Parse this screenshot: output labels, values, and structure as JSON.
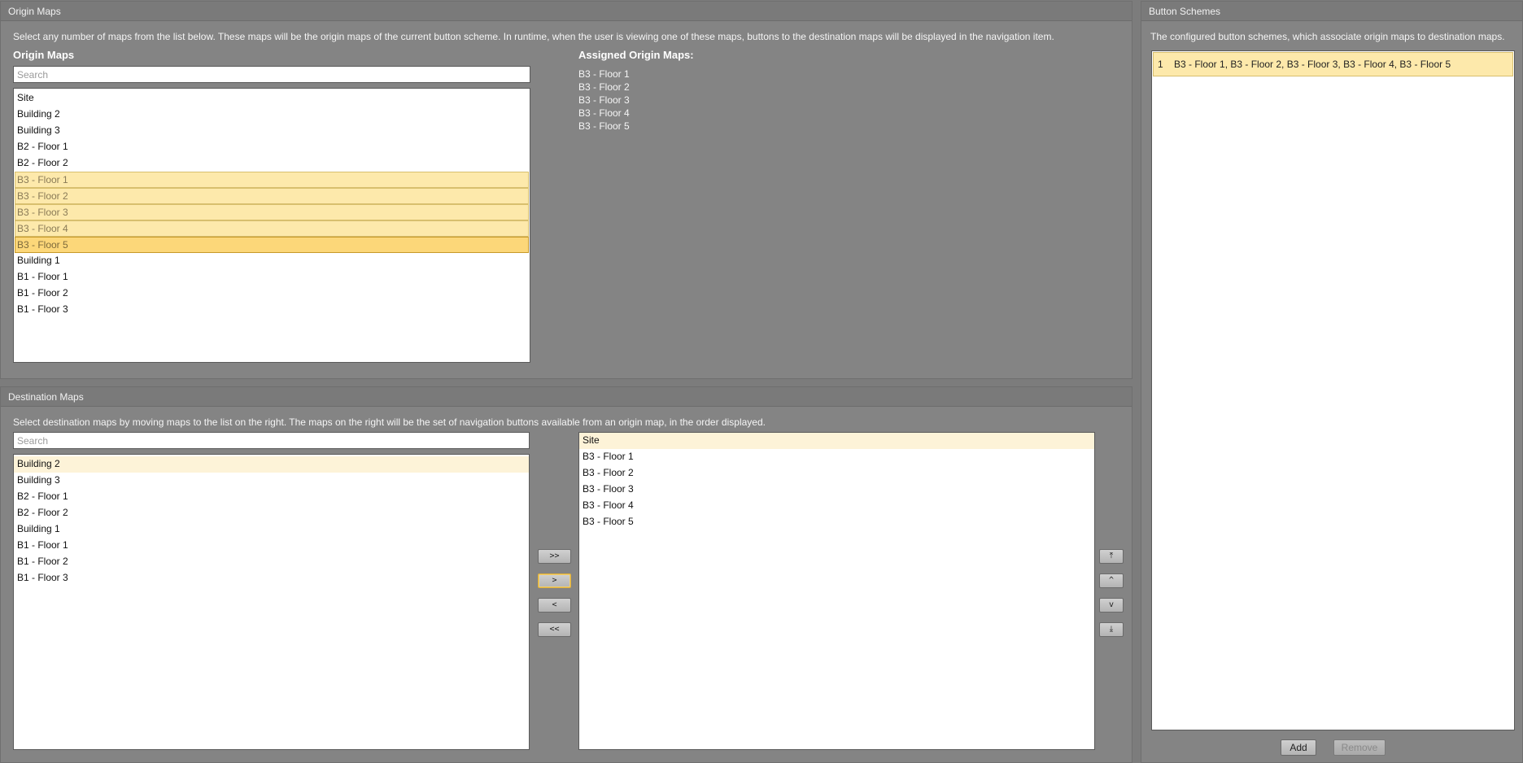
{
  "origin_panel": {
    "title": "Origin Maps",
    "description": "Select any number of maps from the list below. These maps will be the origin maps of the current button scheme. In runtime, when the user is viewing one of these maps, buttons to the destination maps will be displayed in the navigation item.",
    "list_heading": "Origin Maps",
    "search_placeholder": "Search",
    "items": [
      {
        "label": "Site",
        "state": "normal"
      },
      {
        "label": "Building 2",
        "state": "normal"
      },
      {
        "label": "Building 3",
        "state": "normal"
      },
      {
        "label": "B2 - Floor 1",
        "state": "normal"
      },
      {
        "label": "B2 - Floor 2",
        "state": "normal"
      },
      {
        "label": "B3 - Floor 1",
        "state": "selected"
      },
      {
        "label": "B3 - Floor 2",
        "state": "selected"
      },
      {
        "label": "B3 - Floor 3",
        "state": "selected"
      },
      {
        "label": "B3 - Floor 4",
        "state": "selected"
      },
      {
        "label": "B3 - Floor 5",
        "state": "selected-active"
      },
      {
        "label": "Building 1",
        "state": "normal"
      },
      {
        "label": "B1 - Floor 1",
        "state": "normal"
      },
      {
        "label": "B1 - Floor 2",
        "state": "normal"
      },
      {
        "label": "B1 - Floor 3",
        "state": "normal"
      }
    ],
    "assigned_heading": "Assigned Origin Maps:",
    "assigned": [
      "B3 - Floor 1",
      "B3 - Floor 2",
      "B3 - Floor 3",
      "B3 - Floor 4",
      "B3 - Floor 5"
    ]
  },
  "destination_panel": {
    "title": "Destination Maps",
    "description": "Select destination maps by moving maps to the list on the right. The maps on the right will be the set of navigation buttons available from an origin map, in the order displayed.",
    "search_placeholder": "Search",
    "available": [
      {
        "label": "Building 2",
        "state": "hover"
      },
      {
        "label": "Building 3",
        "state": "normal"
      },
      {
        "label": "B2 - Floor 1",
        "state": "normal"
      },
      {
        "label": "B2 - Floor 2",
        "state": "normal"
      },
      {
        "label": "Building 1",
        "state": "normal"
      },
      {
        "label": "B1 - Floor 1",
        "state": "normal"
      },
      {
        "label": "B1 - Floor 2",
        "state": "normal"
      },
      {
        "label": "B1 - Floor 3",
        "state": "normal"
      }
    ],
    "selected": [
      {
        "label": "Site",
        "state": "hover"
      },
      {
        "label": "B3 - Floor 1",
        "state": "normal"
      },
      {
        "label": "B3 - Floor 2",
        "state": "normal"
      },
      {
        "label": "B3 - Floor 3",
        "state": "normal"
      },
      {
        "label": "B3 - Floor 4",
        "state": "normal"
      },
      {
        "label": "B3 - Floor 5",
        "state": "normal"
      }
    ],
    "transfer_buttons": {
      "add_all": ">>",
      "add": ">",
      "remove": "<",
      "remove_all": "<<"
    },
    "order_buttons": {
      "move_top": "⤒",
      "move_up": "^",
      "move_down": "v",
      "move_bottom": "⤓"
    }
  },
  "schemes_panel": {
    "title": "Button Schemes",
    "description": "The configured button schemes, which associate origin maps to destination maps.",
    "schemes": [
      {
        "index": "1",
        "maps": "B3 - Floor 1, B3 - Floor 2, B3 - Floor 3, B3 - Floor 4, B3 - Floor 5"
      }
    ],
    "add_label": "Add",
    "remove_label": "Remove"
  }
}
